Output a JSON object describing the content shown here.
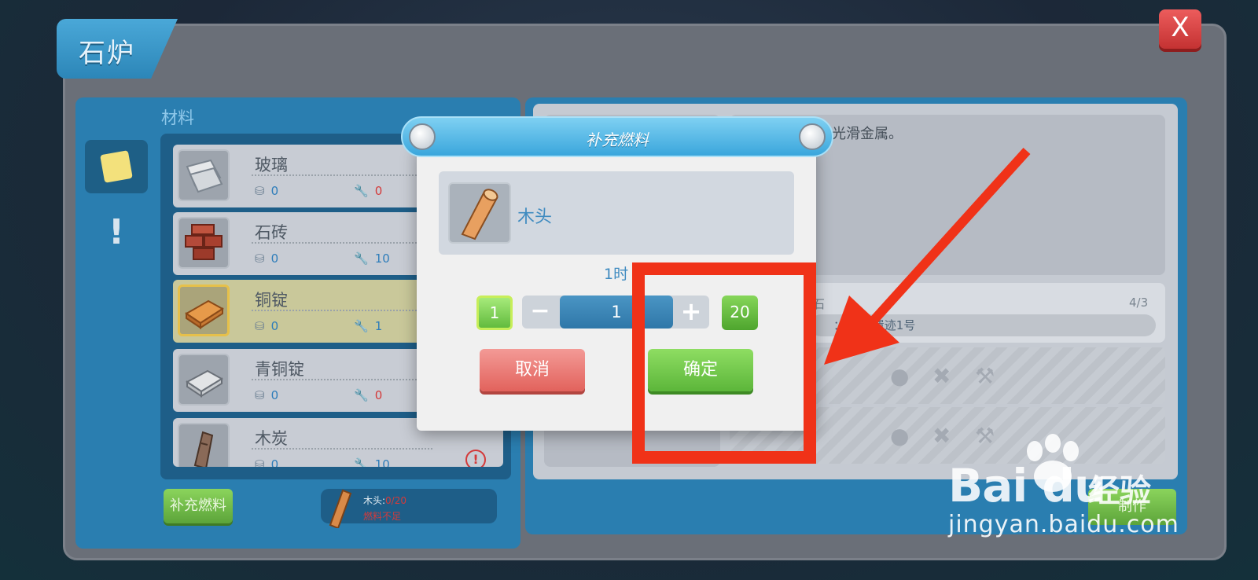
{
  "window": {
    "title": "石炉",
    "close_label": "X"
  },
  "left_panel": {
    "section_label": "材料",
    "items": [
      {
        "name": "玻璃",
        "count_a": "0",
        "count_b": "0",
        "count_b_color": "red",
        "warn": false,
        "selected": false
      },
      {
        "name": "石砖",
        "count_a": "0",
        "count_b": "10",
        "count_b_color": "blue",
        "warn": false,
        "selected": false
      },
      {
        "name": "铜锭",
        "count_a": "0",
        "count_b": "1",
        "count_b_color": "blue",
        "warn": false,
        "selected": true
      },
      {
        "name": "青铜锭",
        "count_a": "0",
        "count_b": "0",
        "count_b_color": "red",
        "warn": false,
        "selected": false
      },
      {
        "name": "木炭",
        "count_a": "0",
        "count_b": "10",
        "count_b_color": "blue",
        "warn": true,
        "selected": false
      }
    ],
    "refuel_button": "补充燃料",
    "fuel_status": {
      "label": "木头:",
      "value": "0/20",
      "note": "燃料不足"
    }
  },
  "right_panel": {
    "description": "的光滑金属。",
    "requirement": {
      "name": "石",
      "count": "4/3",
      "location": "：  废弃遗迹1号"
    },
    "make_button": "制作"
  },
  "dialog": {
    "title": "补充燃料",
    "fuel_name": "木头",
    "time_text": "1时",
    "min_label": "1",
    "quantity": "1",
    "max_label": "20",
    "cancel_label": "取消",
    "confirm_label": "确定"
  },
  "watermark": {
    "brand": "Bai du",
    "brand_cn": "经验",
    "url": "jingyan.baidu.com"
  },
  "colors": {
    "accent_blue": "#2a7eb0",
    "confirm_green": "#5cb63a",
    "cancel_red": "#e2625c",
    "annotation_red": "#f03218"
  }
}
